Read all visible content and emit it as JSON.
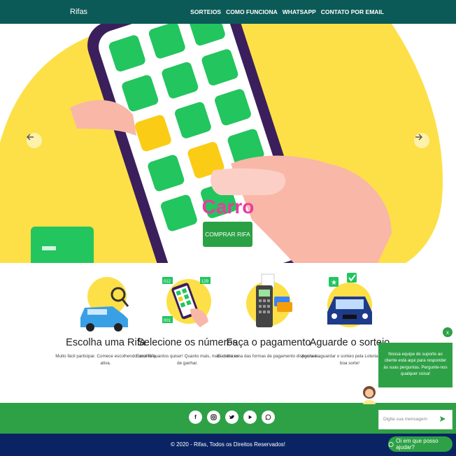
{
  "nav": {
    "brand": "Rifas",
    "items": [
      "SORTEIOS",
      "COMO FUNCIONA",
      "WHATSAPP",
      "CONTATO POR EMAIL"
    ]
  },
  "hero": {
    "title": "Carro",
    "button": "COMPRAR RIFA"
  },
  "steps": [
    {
      "title": "Escolha uma Rifa",
      "desc": "Muito fácil participar. Comece escolhendo uma Rifa ativa."
    },
    {
      "title": "Selecione os números",
      "desc": "Escolha quantos quiser! Quanto mais, mais chances de ganhar."
    },
    {
      "title": "Faça o pagamento",
      "desc": "Escolha uma das formas de pagamento disponíveis."
    },
    {
      "title": "Aguarde o sorteio",
      "desc": "Agora é aguardar o sorteio pela Loteria Federal e boa sorte!"
    }
  ],
  "step_icon_numbers": [
    "012",
    "129",
    "001"
  ],
  "social_icons": [
    "facebook-icon",
    "instagram-icon",
    "twitter-icon",
    "youtube-icon",
    "whatsapp-icon"
  ],
  "footer": {
    "copyright": "© 2020 - Rifas, Todos os Direitos Reservados!"
  },
  "chat": {
    "close": "x",
    "message": "Nossa equipe de suporte ao cliente está aqui para responder às suas perguntas. Pergunte-nos qualquer coisa!",
    "placeholder": "Digita sua mensagem",
    "help_button": "Oi em que posso ajudar?"
  },
  "colors": {
    "nav": "#0c5a57",
    "accent_green": "#2ea146",
    "hero_yellow": "#fde047",
    "title_pink": "#e83d9e",
    "footer_navy": "#0a2463"
  }
}
